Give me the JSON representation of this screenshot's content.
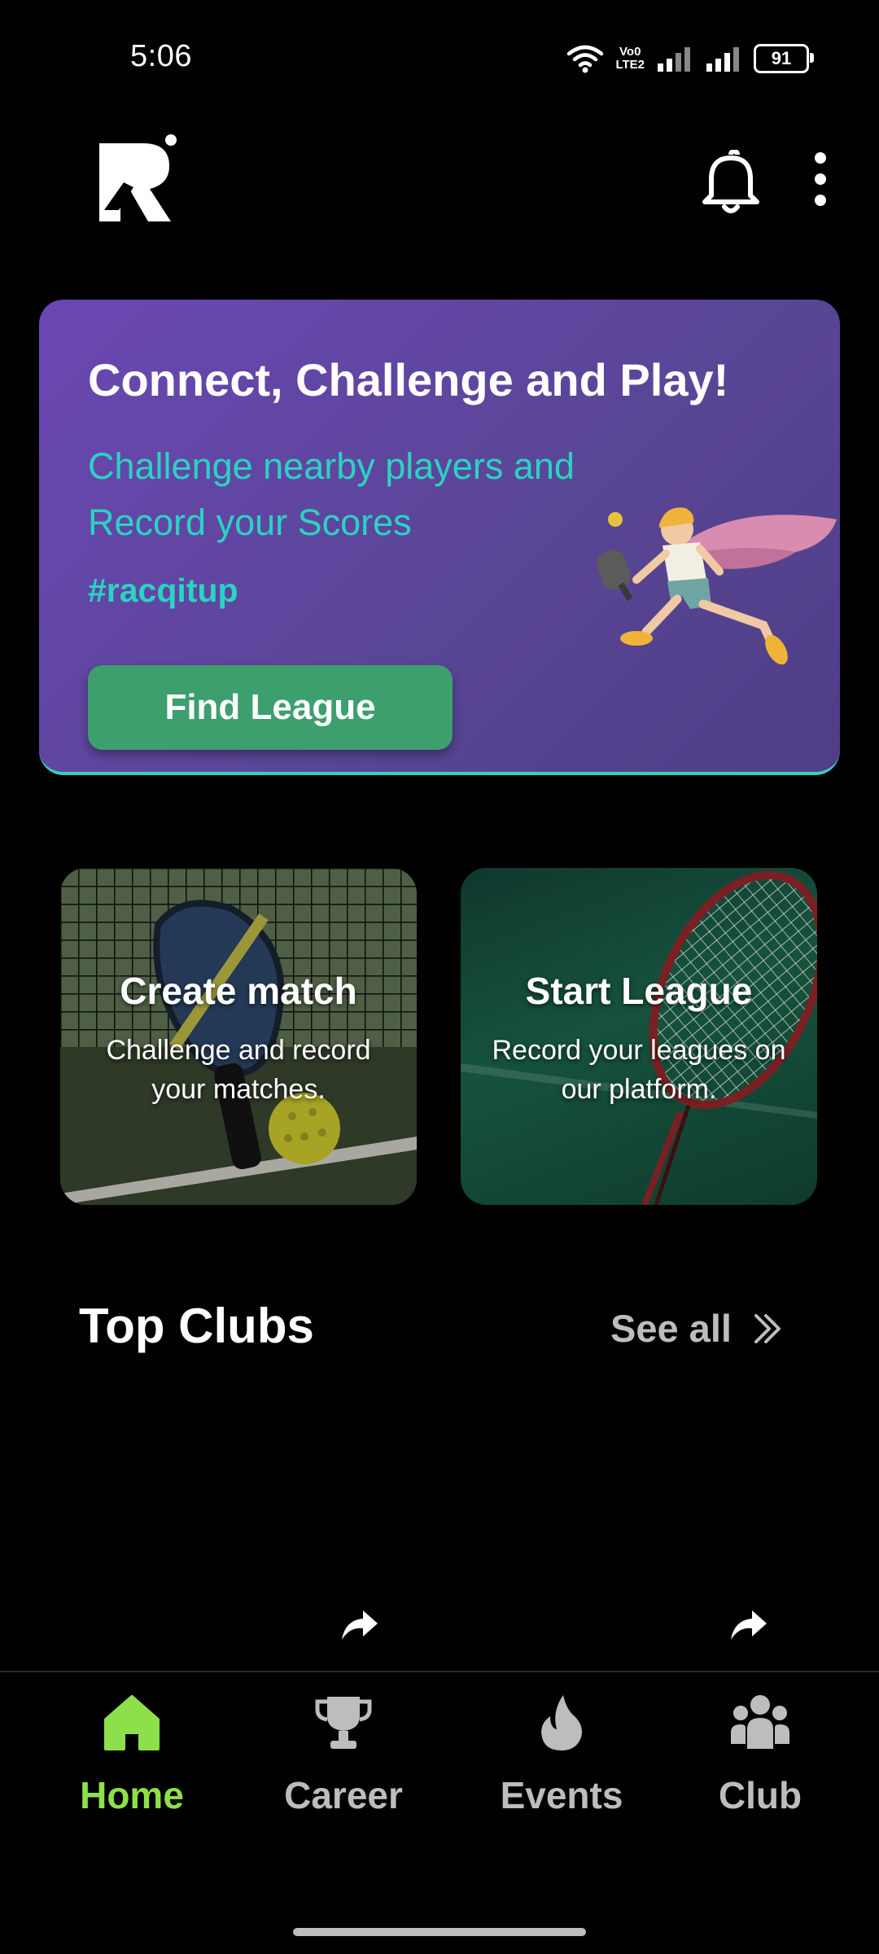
{
  "status_bar": {
    "time": "5:06",
    "network_line1": "Vo0",
    "network_line2": "LTE2",
    "battery": "91"
  },
  "app_bar": {
    "logo_icon": "racq-logo",
    "notification_icon": "bell-icon",
    "menu_icon": "more-vertical-icon"
  },
  "hero": {
    "title": "Connect, Challenge and Play!",
    "subtitle": "Challenge nearby players and Record your Scores",
    "hashtag": "#racqitup",
    "button_label": "Find League",
    "illustration": "flying-pickleball-player"
  },
  "feature_cards": [
    {
      "title": "Create match",
      "description": "Challenge and record your matches."
    },
    {
      "title": "Start League",
      "description": "Record your leagues on our platform."
    }
  ],
  "top_clubs": {
    "title": "Top Clubs",
    "see_all": "See all",
    "share_icon": "share-icon"
  },
  "bottom_nav": {
    "items": [
      {
        "label": "Home",
        "icon": "home-icon",
        "active": true
      },
      {
        "label": "Career",
        "icon": "trophy-icon",
        "active": false
      },
      {
        "label": "Events",
        "icon": "flame-icon",
        "active": false
      },
      {
        "label": "Club",
        "icon": "group-icon",
        "active": false
      }
    ]
  },
  "colors": {
    "background": "#000000",
    "hero_gradient_start": "#6a47b3",
    "hero_gradient_end": "#4f3e86",
    "accent_teal": "#2ad3c2",
    "button_green": "#3d9e6e",
    "nav_active": "#8ee04b",
    "nav_inactive": "#bdbdbd"
  }
}
